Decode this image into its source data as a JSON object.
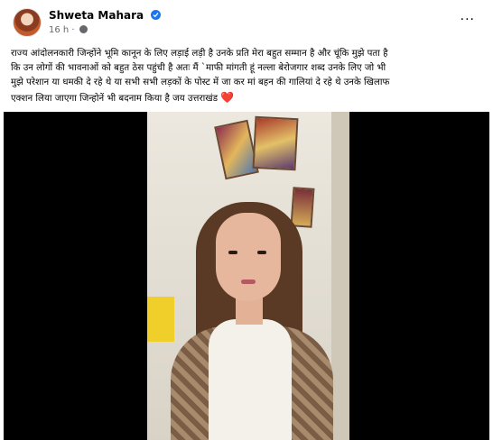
{
  "post": {
    "author_name": "Shweta Mahara",
    "timestamp": "16 h ·",
    "more_label": "···",
    "caption_lines": [
      "राज्य आंदोलनकारी जिन्होंने भूमि कानून के लिए लड़ाई लड़ी है उनके प्रति मेरा बहुत सम्मान है और चूंकि मुझे पता है",
      "कि उन लोगों की भावनाओं को बहुत ठेस पहुंची है अतः मैं `माफी मांगती हूं नल्ला बेरोजगार शब्द उनके लिए जो भी",
      "मुझे परेशान या धमकी दे रहे थे या सभी सभी लड़कों के पोस्ट में जा कर मां बहन की गालियां दे रहे थे उनके खिलाफ",
      "एक्शन लिया जाएगा जिन्होनें भी बदनाम किया है जय उत्तराखंड"
    ],
    "caption_emoji": "❤️"
  },
  "icons": {
    "verified": "verified-badge-icon",
    "privacy": "globe-icon",
    "more": "more-options-icon"
  },
  "colors": {
    "accent": "#1877f2",
    "text": "#050505",
    "secondary": "#65676b",
    "heart": "#e0245e"
  }
}
